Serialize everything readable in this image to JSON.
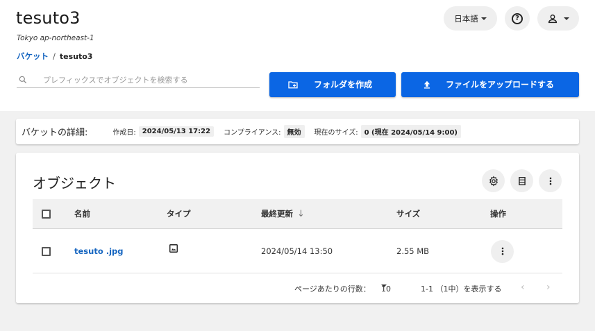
{
  "header": {
    "title": "tesuto3",
    "region": "Tokyo ap-northeast-1",
    "language": "日本語"
  },
  "breadcrumb": {
    "root": "バケット",
    "separator": "/",
    "current": "tesuto3"
  },
  "search": {
    "placeholder": "プレフィックスでオブジェクトを検索する"
  },
  "actions": {
    "create_folder": "フォルダを作成",
    "upload_file": "ファイルをアップロードする"
  },
  "details": {
    "heading": "バケットの詳細:",
    "created_label": "作成日:",
    "created_value": "2024/05/13 17:22",
    "compliance_label": "コンプライアンス:",
    "compliance_value": "無効",
    "size_label": "現在のサイズ:",
    "size_value": "0 (現在 2024/05/14 9:00)"
  },
  "objects": {
    "title": "オブジェクト",
    "columns": {
      "name": "名前",
      "type": "タイプ",
      "modified": "最終更新",
      "size": "サイズ",
      "actions": "操作"
    },
    "rows": [
      {
        "name": "tesuto .jpg",
        "type_icon": "image-icon",
        "modified": "2024/05/14 13:50",
        "size": "2.55 MB"
      }
    ]
  },
  "pagination": {
    "rows_per_page_label": "ページあたりの行数：",
    "rows_per_page_value": "10",
    "range": "1-1 （1中）を表示する"
  },
  "colors": {
    "accent": "#0b66e4",
    "link": "#1565c0",
    "background": "#f1f1f1"
  }
}
